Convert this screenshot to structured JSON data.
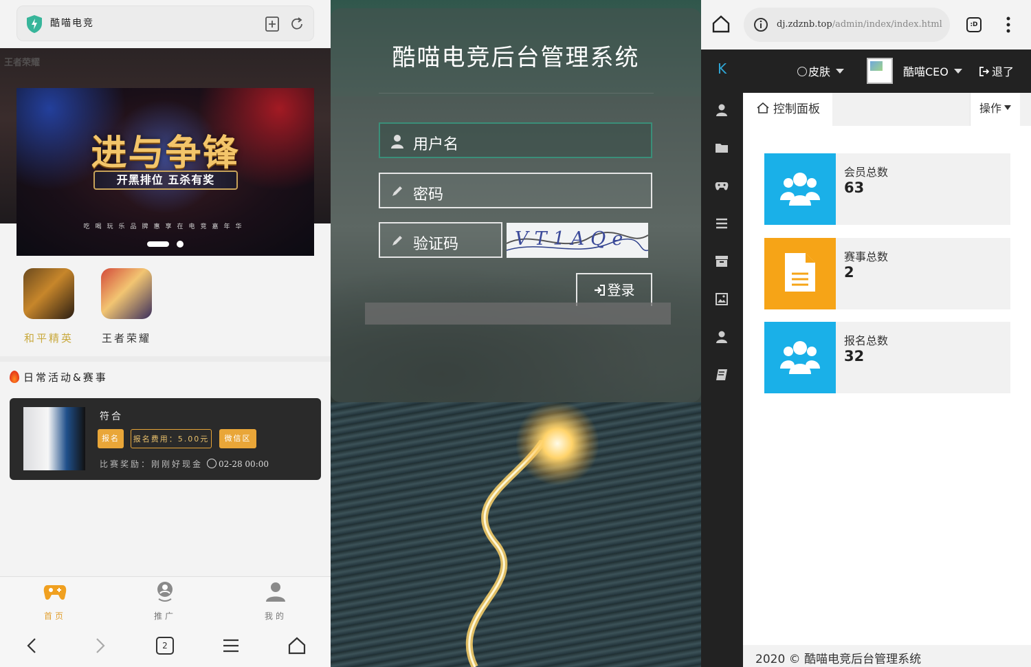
{
  "left": {
    "browser": {
      "site_name": "酷喵电竞"
    },
    "banner": {
      "watermark": "王者荣耀",
      "headline": "进与争锋",
      "ribbon": "开黑排位 五杀有奖",
      "subline": "吃喝玩乐品牌惠享在电竞嘉年华"
    },
    "games": [
      {
        "name": "和平精英"
      },
      {
        "name": "王者荣耀"
      }
    ],
    "section_title": "日常活动&赛事",
    "event": {
      "title": "符合",
      "tags": [
        "报名",
        "报名费用：5.00元",
        "微信区"
      ],
      "reward": "比赛奖励：刚刚好现金",
      "time": "02-28 00:00"
    },
    "tabbar": [
      {
        "label": "首页"
      },
      {
        "label": "推广"
      },
      {
        "label": "我的"
      }
    ],
    "browser_nav": {
      "tab_count": "2"
    }
  },
  "middle": {
    "title": "酷喵电竞后台管理系统",
    "username_placeholder": "用户名",
    "password_placeholder": "密码",
    "captcha_placeholder": "验证码",
    "captcha_text": "VT1AQe",
    "login_label": "登录"
  },
  "right": {
    "browser": {
      "url_domain": "dj.zdznb.top",
      "url_path": "/admin/index/index.html",
      "tabs_icon_text": ":D"
    },
    "header": {
      "logo": "K",
      "skin_label": "皮肤",
      "username": "酷喵CEO",
      "logout_label": "退了"
    },
    "tab_label": "控制面板",
    "operate_label": "操作",
    "stats": [
      {
        "label": "会员总数",
        "value": "63",
        "color": "#1ab0e8"
      },
      {
        "label": "赛事总数",
        "value": "2",
        "color": "#f6a417"
      },
      {
        "label": "报名总数",
        "value": "32",
        "color": "#1ab0e8"
      }
    ],
    "footer": "2020 © 酷喵电竞后台管理系统"
  }
}
